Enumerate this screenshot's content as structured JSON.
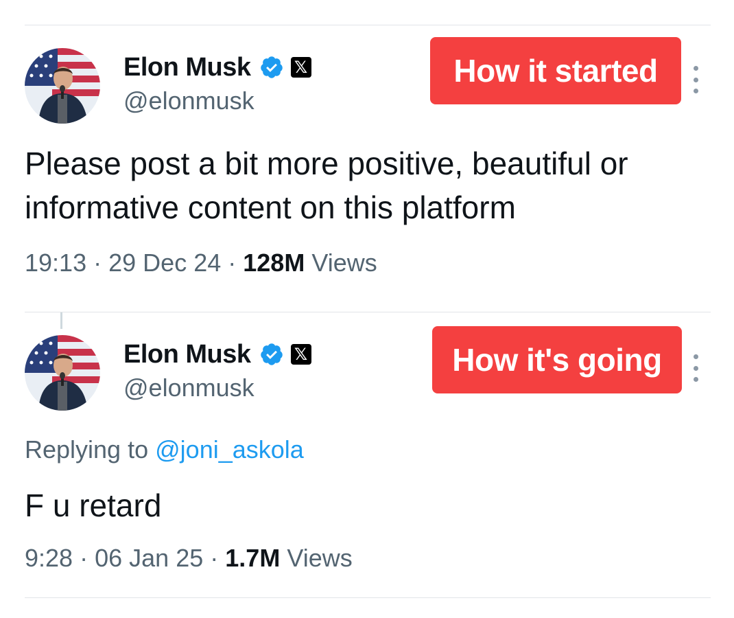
{
  "tweets": [
    {
      "author_name": "Elon Musk",
      "handle": "@elonmusk",
      "x_badge": "𝕏",
      "label": "How it started",
      "text": "Please post a bit more positive, beautiful or informative content on this platform",
      "time": "19:13",
      "date": "29 Dec 24",
      "views_count": "128M",
      "views_label": "Views"
    },
    {
      "author_name": "Elon Musk",
      "handle": "@elonmusk",
      "x_badge": "𝕏",
      "label": "How it's going",
      "replying_prefix": "Replying to",
      "replying_handle": "@joni_askola",
      "text": "F u retard",
      "time": "9:28",
      "date": "06 Jan 25",
      "views_count": "1.7M",
      "views_label": "Views"
    }
  ],
  "separator": "·",
  "colors": {
    "label_background": "#f44040",
    "verified_blue": "#1d9bf0",
    "link_blue": "#1d9bf0",
    "secondary_text": "#536471"
  },
  "icons": {
    "verified": "verified-badge-icon",
    "x_logo": "x-logo-icon",
    "more": "more-options-icon"
  }
}
